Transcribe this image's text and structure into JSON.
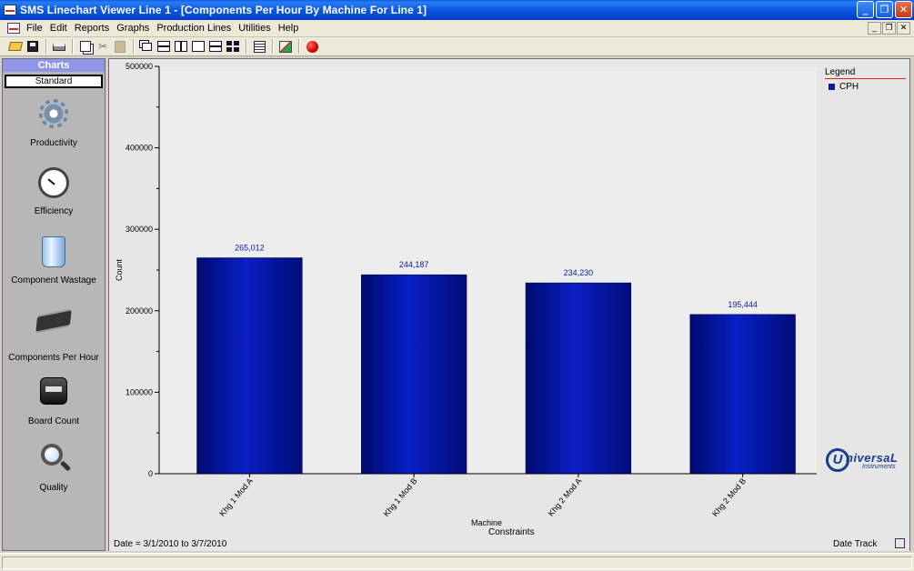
{
  "window": {
    "title": "SMS Linechart Viewer Line 1 - [Components Per Hour By Machine For Line 1]",
    "minimize": "_",
    "restore": "❐",
    "close": "✕"
  },
  "menu": {
    "items": [
      "File",
      "Edit",
      "Reports",
      "Graphs",
      "Production Lines",
      "Utilities",
      "Help"
    ],
    "mdi_minimize": "_",
    "mdi_restore": "❐",
    "mdi_close": "✕"
  },
  "toolbar": {
    "icons": [
      "open-icon",
      "save-icon",
      "print-icon",
      "copy-icon",
      "cut-icon",
      "paste-icon",
      "cascade-windows-icon",
      "tile-horizontal-icon",
      "tile-vertical-icon",
      "arrange-icons-icon",
      "minimize-windows-icon",
      "grid-windows-icon",
      "calculator-icon",
      "swap-icon",
      "record-icon"
    ]
  },
  "sidebar": {
    "header": "Charts",
    "tab": "Standard",
    "items": [
      {
        "label": "Productivity",
        "icon": "gear-icon"
      },
      {
        "label": "Efficiency",
        "icon": "gauge-icon"
      },
      {
        "label": "Component Wastage",
        "icon": "recycle-bin-icon"
      },
      {
        "label": "Components Per Hour",
        "icon": "chip-icon"
      },
      {
        "label": "Board Count",
        "icon": "counter-icon"
      },
      {
        "label": "Quality",
        "icon": "magnifier-icon"
      }
    ]
  },
  "legend": {
    "title": "Legend",
    "series": "CPH",
    "series_color": "#0a1a9a"
  },
  "brand": {
    "mark": "U",
    "name": "niversaL",
    "sub": "Instruments"
  },
  "chart_data": {
    "type": "bar",
    "categories": [
      "Khg 1 Mod A",
      "Khg 1 Mod B",
      "Khg 2 Mod A",
      "Khg 2 Mod B"
    ],
    "series": [
      {
        "name": "CPH",
        "values": [
          265012,
          244187,
          234230,
          195444
        ],
        "labels": [
          "265,012",
          "244,187",
          "234,230",
          "195,444"
        ],
        "color": "#0a1a9a"
      }
    ],
    "yticks": [
      "0",
      "100000",
      "200000",
      "300000",
      "400000",
      "500000"
    ],
    "ylim": [
      0,
      500000
    ],
    "ylabel": "Count",
    "xlabel": "Machine",
    "xlabel2": "Constraints",
    "grid": false,
    "legend_position": "right"
  },
  "footer": {
    "date_range": "Date = 3/1/2010 to 3/7/2010",
    "date_track": "Date Track"
  }
}
